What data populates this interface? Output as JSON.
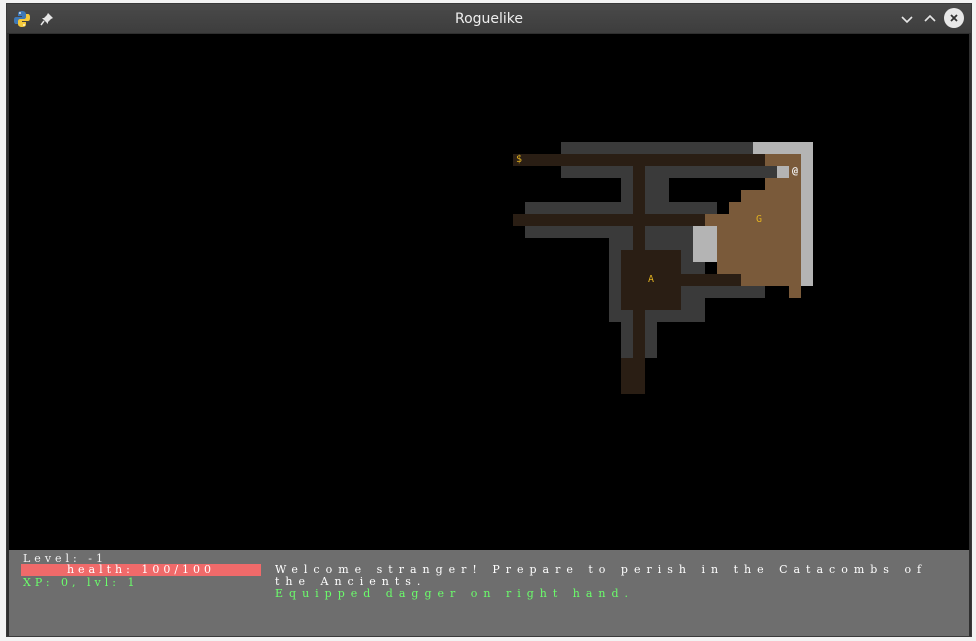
{
  "window": {
    "title": "Roguelike",
    "icons": [
      "python-logo-icon",
      "pin-icon",
      "minimize-icon",
      "maximize-icon",
      "close-icon"
    ]
  },
  "map": {
    "colors": {
      "wall_dark": "#3a3a3a",
      "floor_dark": "#2a1e14",
      "floor_lit": "#7a5a3a",
      "wall_lit": "#b4b4b4",
      "item": "#e0b020"
    },
    "entities": [
      {
        "name": "gold-pile",
        "glyph": "$",
        "color": "#e0b020"
      },
      {
        "name": "player",
        "glyph": "@",
        "color": "#f0f0f0"
      },
      {
        "name": "goblin",
        "glyph": "G",
        "color": "#e0b020"
      },
      {
        "name": "ancient",
        "glyph": "A",
        "color": "#e0b020"
      }
    ]
  },
  "hud": {
    "level": "Level: -1",
    "health": "health: 100/100",
    "health_color": "#f06a6a",
    "xp": "XP: 0, lvl: 1",
    "messages": [
      {
        "text": "Welcome stranger! Prepare to perish in the Catacombs of the Ancients.",
        "color": "#ffffff"
      },
      {
        "text": "Equipped dagger on right hand.",
        "color": "#6bff6b"
      }
    ]
  }
}
